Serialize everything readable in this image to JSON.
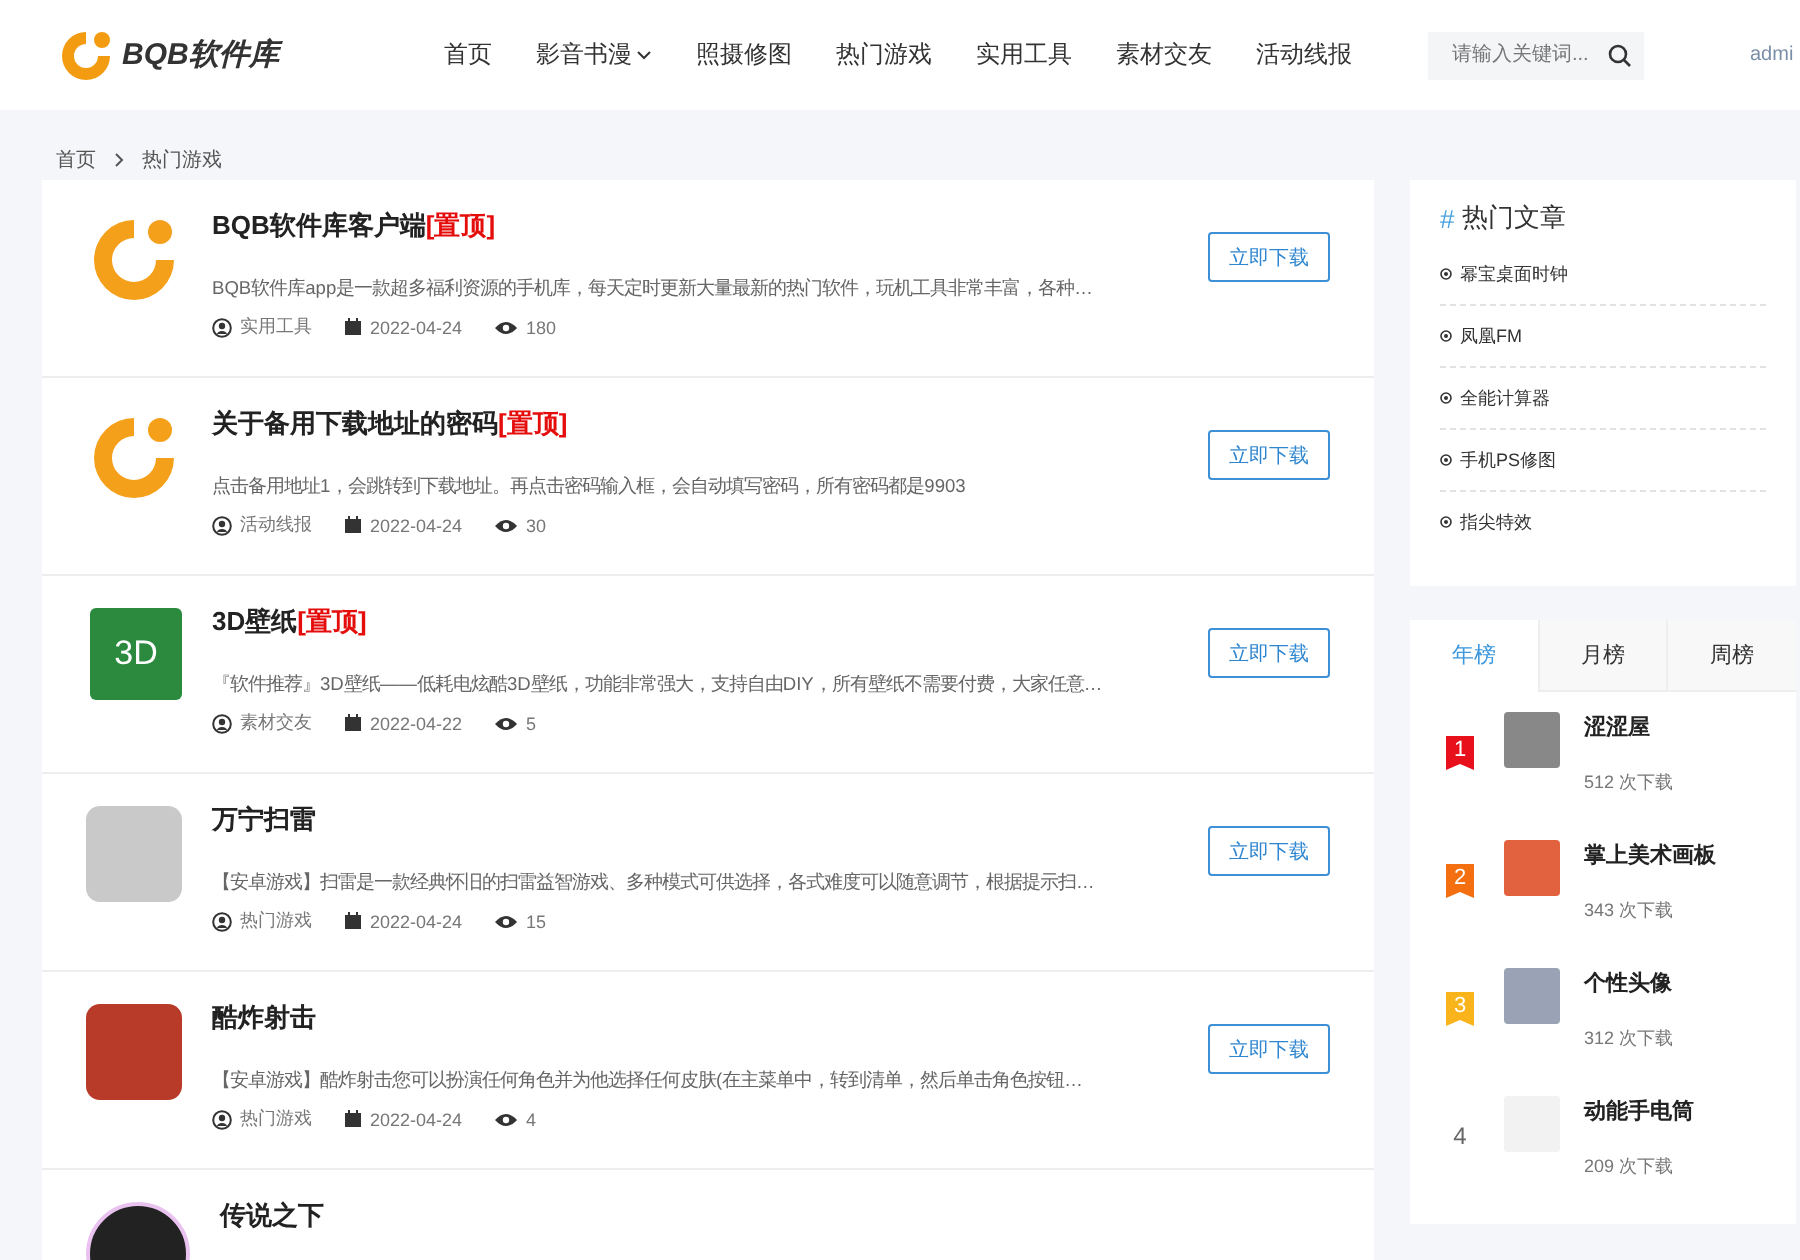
{
  "header": {
    "logo_text": "BQB软件库",
    "nav": [
      {
        "label": "首页",
        "dropdown": false
      },
      {
        "label": "影音书漫",
        "dropdown": true
      },
      {
        "label": "照摄修图",
        "dropdown": false
      },
      {
        "label": "热门游戏",
        "dropdown": false
      },
      {
        "label": "实用工具",
        "dropdown": false
      },
      {
        "label": "素材交友",
        "dropdown": false
      },
      {
        "label": "活动线报",
        "dropdown": false
      }
    ],
    "search": {
      "placeholder": "请输入关键词..."
    },
    "user": "admi"
  },
  "breadcrumb": [
    "首页",
    "热门游戏"
  ],
  "posts": [
    {
      "kind": "logo",
      "title": "BQB软件库客户端",
      "tag": "[置顶]",
      "description": "BQB软件库app是一款超多福利资源的手机库，每天定时更新大量最新的热门软件，玩机工具非常丰富，各种…",
      "category": "实用工具",
      "date": "2022-04-24",
      "views": "180",
      "button": "立即下载"
    },
    {
      "kind": "logo",
      "title": "关于备用下载地址的密码",
      "tag": "[置顶]",
      "description": "点击备用地址1，会跳转到下载地址。再点击密码输入框，会自动填写密码，所有密码都是9903",
      "category": "活动线报",
      "date": "2022-04-24",
      "views": "30",
      "button": "立即下载"
    },
    {
      "kind": "text",
      "icon_text": "3D",
      "title": "3D壁纸",
      "tag": "[置顶]",
      "description": "『软件推荐』3D壁纸——低耗电炫酷3D壁纸，功能非常强大，支持自由DIY，所有壁纸不需要付费，大家任意…",
      "category": "素材交友",
      "date": "2022-04-22",
      "views": "5",
      "button": "立即下载"
    },
    {
      "kind": "grid",
      "title": "万宁扫雷",
      "description": "【安卓游戏】扫雷是一款经典怀旧的扫雷益智游戏、多种模式可供选择，各式难度可以随意调节，根据提示扫…",
      "category": "热门游戏",
      "date": "2022-04-24",
      "views": "15",
      "button": "立即下载"
    },
    {
      "kind": "photo",
      "title": "酷炸射击",
      "description": "【安卓游戏】酷炸射击您可以扮演任何角色并为他选择任何皮肤(在主菜单中，转到清单，然后单击角色按钮…",
      "category": "热门游戏",
      "date": "2022-04-24",
      "views": "4",
      "button": "立即下载"
    },
    {
      "kind": "round",
      "title": "传说之下"
    }
  ],
  "hot_articles": {
    "marker": "#",
    "title": "热门文章",
    "items": [
      "幂宝桌面时钟",
      "凤凰FM",
      "全能计算器",
      "手机PS修图",
      "指尖特效"
    ]
  },
  "ranking": {
    "tabs": [
      {
        "label": "年榜",
        "selected": true
      },
      {
        "label": "月榜",
        "selected": false
      },
      {
        "label": "周榜",
        "selected": false
      }
    ],
    "items": [
      {
        "rank": "1",
        "color": "#e8111b",
        "name": "涩涩屋",
        "downloads": "512 次下载"
      },
      {
        "rank": "2",
        "color": "#f46f10",
        "name": "掌上美术画板",
        "downloads": "343 次下载"
      },
      {
        "rank": "3",
        "color": "#f8b41a",
        "name": "个性头像",
        "downloads": "312 次下载"
      },
      {
        "rank": "4",
        "name": "动能手电筒",
        "downloads": "209 次下载"
      }
    ]
  }
}
